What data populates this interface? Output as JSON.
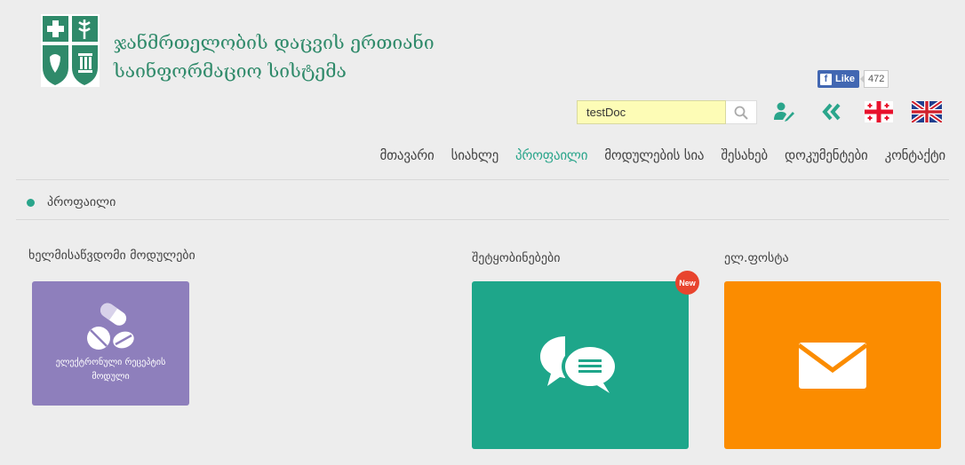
{
  "header": {
    "title_line1": "ჯანმრთელობის დაცვის ერთიანი",
    "title_line2": "საინფორმაციო სისტემა"
  },
  "facebook": {
    "like_label": "Like",
    "like_count": "472"
  },
  "search": {
    "value": "testDoc"
  },
  "nav": {
    "items": [
      {
        "label": "მთავარი"
      },
      {
        "label": "სიახლე"
      },
      {
        "label": "პროფაილი"
      },
      {
        "label": "მოდულების სია"
      },
      {
        "label": "შესახებ"
      },
      {
        "label": "დოკუმენტები"
      },
      {
        "label": "კონტაქტი"
      }
    ],
    "active_index": 2
  },
  "breadcrumb": {
    "current": "პროფაილი"
  },
  "sections": {
    "modules_title": "ხელმისაწვდომი მოდულები",
    "messages_title": "შეტყობინებები",
    "email_title": "ელ.ფოსტა"
  },
  "tiles": {
    "rx_label": "ელექტრონული რეცეპტის მოდული",
    "new_badge": "New"
  },
  "colors": {
    "accent": "#2aa58b",
    "rx_tile": "#8e7fbc",
    "messages_tile": "#1ea68a",
    "email_tile": "#fb8c00",
    "badge": "#e8442e"
  },
  "icons": {
    "logo": "health-cross-logo-icon",
    "search": "search-icon",
    "doctor": "doctor-edit-icon",
    "back": "double-chevron-left-icon",
    "flag_ge": "georgia-flag-icon",
    "flag_uk": "uk-flag-icon",
    "pills": "pills-icon",
    "chat": "chat-bubbles-icon",
    "mail": "envelope-icon"
  }
}
